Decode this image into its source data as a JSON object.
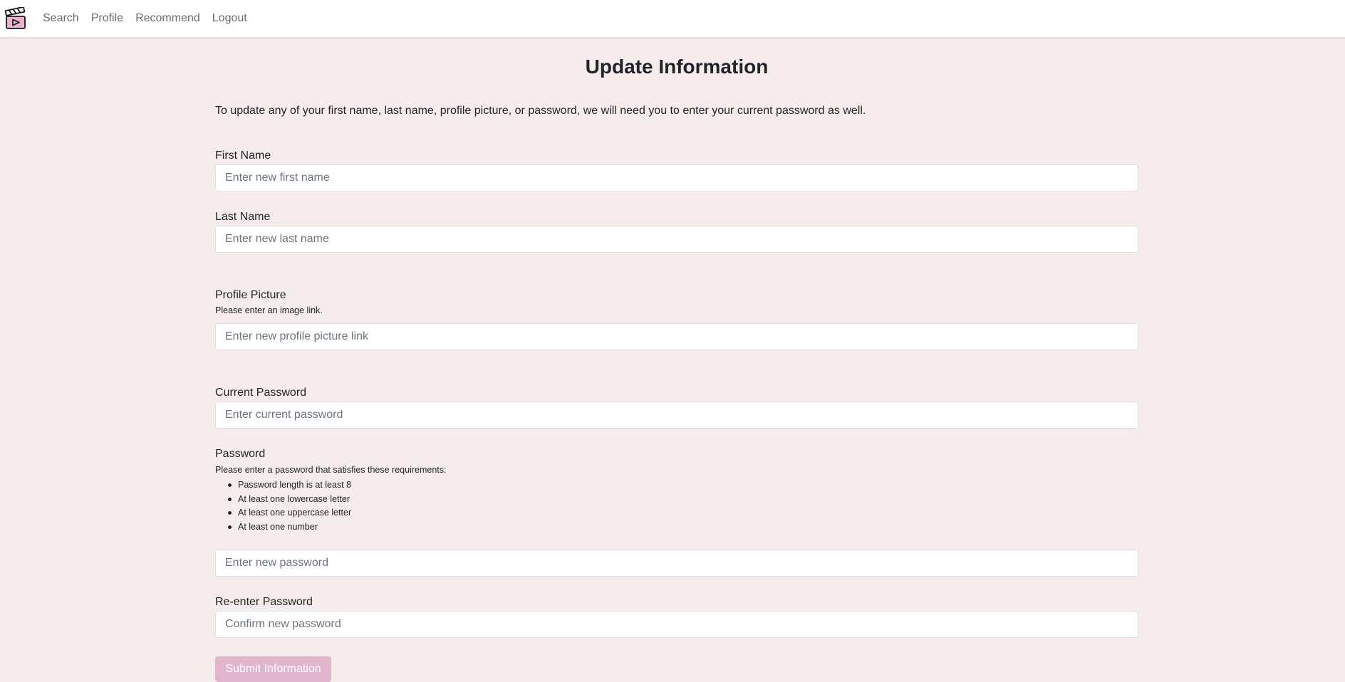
{
  "nav": {
    "logo_icon": "clapperboard-icon",
    "links": [
      "Search",
      "Profile",
      "Recommend",
      "Logout"
    ]
  },
  "page": {
    "title": "Update Information",
    "intro": "To update any of your first name, last name, profile picture, or password, we will need you to enter your current password as well."
  },
  "form": {
    "first_name": {
      "label": "First Name",
      "placeholder": "Enter new first name",
      "value": ""
    },
    "last_name": {
      "label": "Last Name",
      "placeholder": "Enter new last name",
      "value": ""
    },
    "profile_picture": {
      "label": "Profile Picture",
      "hint": "Please enter an image link.",
      "placeholder": "Enter new profile picture link",
      "value": ""
    },
    "current_password": {
      "label": "Current Password",
      "placeholder": "Enter current password",
      "value": ""
    },
    "password": {
      "label": "Password",
      "hint": "Please enter a password that satisfies these requirements:",
      "requirements": [
        "Password length is at least 8",
        "At least one lowercase letter",
        "At least one uppercase letter",
        "At least one number"
      ],
      "placeholder": "Enter new password",
      "value": ""
    },
    "confirm_password": {
      "label": "Re-enter Password",
      "placeholder": "Confirm new password",
      "value": ""
    },
    "submit_label": "Submit Information"
  },
  "colors": {
    "background": "#f5eceb",
    "accent": "#e2b5cf",
    "logo_fill": "#e8b4d0"
  }
}
